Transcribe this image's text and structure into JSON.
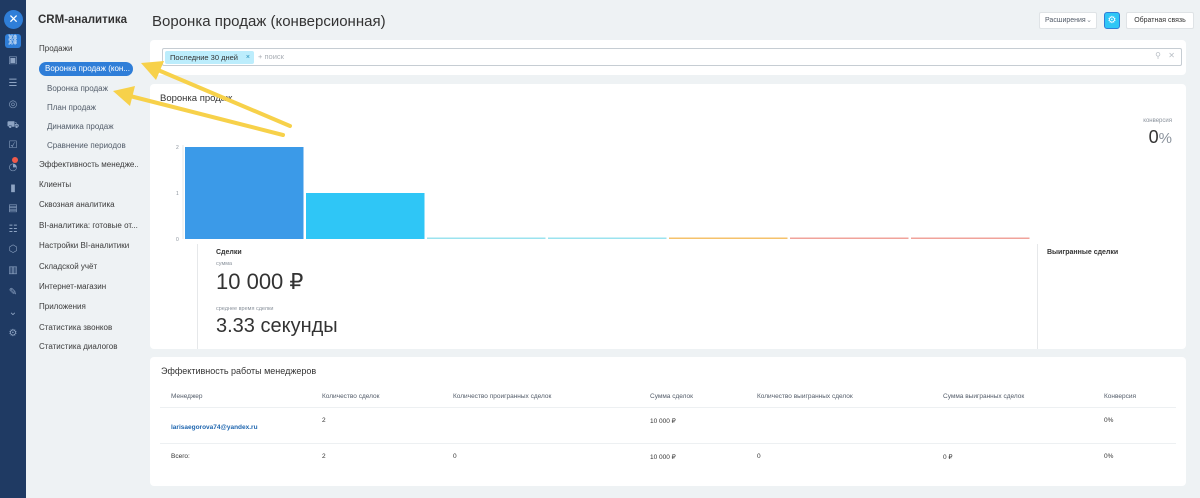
{
  "app": {
    "title": "CRM-аналитика"
  },
  "menu": {
    "items": [
      {
        "label": "Продажи",
        "level": 0
      },
      {
        "label": "Воронка продаж (кон...",
        "level": 0,
        "active": true
      },
      {
        "label": "Воронка продаж",
        "level": 1
      },
      {
        "label": "План продаж",
        "level": 1
      },
      {
        "label": "Динамика продаж",
        "level": 1
      },
      {
        "label": "Сравнение периодов",
        "level": 1
      },
      {
        "label": "Эффективность менедже...",
        "level": 0
      },
      {
        "label": "Клиенты",
        "level": 0
      },
      {
        "label": "Сквозная аналитика",
        "level": 0
      },
      {
        "label": "BI-аналитика: готовые от...",
        "level": 0
      },
      {
        "label": "Настройки BI-аналитики",
        "level": 0
      },
      {
        "label": "Складской учёт",
        "level": 0
      },
      {
        "label": "Интернет-магазин",
        "level": 0
      },
      {
        "label": "Приложения",
        "level": 0
      },
      {
        "label": "Статистика звонков",
        "level": 0
      },
      {
        "label": "Статистика диалогов",
        "level": 0
      }
    ]
  },
  "rail": {
    "close_icon": "✕"
  },
  "header": {
    "title": "Воронка продаж (конверсионная)",
    "extensions_label": "Расширения",
    "feedback_label": "Обратная связь"
  },
  "filter": {
    "chip_label": "Последние 30 дней",
    "chip_remove": "×",
    "search_placeholder": "+ поиск"
  },
  "funnel": {
    "title": "Воронка продаж",
    "conversion_label": "конверсия",
    "conversion_value": "0",
    "conversion_unit": "%",
    "deals_label": "Сделки",
    "sum_label": "сумма",
    "sum_value": "10 000 ₽",
    "avg_time_label": "среднее время сделки",
    "avg_time_value": "3.33 секунды",
    "won_label": "Выигранные сделки"
  },
  "chart_data": {
    "type": "bar",
    "categories": [
      "",
      "",
      "",
      "",
      "",
      "",
      ""
    ],
    "values": [
      2,
      1,
      0,
      0,
      0,
      0,
      0
    ],
    "colors": [
      "#3b9ae8",
      "#2fc6f6",
      "#9be3ef",
      "#9be3ef",
      "#f5c26b",
      "#f0a39b",
      "#f0a39b"
    ],
    "yticks": [
      "2",
      "1",
      "0"
    ],
    "ylim": [
      0,
      2
    ],
    "title": "",
    "xlabel": "",
    "ylabel": ""
  },
  "managers_table": {
    "title": "Эффективность работы менеджеров",
    "columns": [
      "Менеджер",
      "Количество сделок",
      "Количество проигранных сделок",
      "Сумма сделок",
      "Количество выигранных сделок",
      "Сумма выигранных сделок",
      "Конверсия"
    ],
    "rows": [
      [
        "larisaegorova74@yandex.ru",
        "2",
        "",
        "10 000 ₽",
        "",
        "",
        "0%"
      ]
    ],
    "total": [
      "Всего:",
      "2",
      "0",
      "10 000 ₽",
      "0",
      "0 ₽",
      "0%"
    ]
  },
  "colors": {
    "accent": "#2f7ed8",
    "arrow": "#f7d14a"
  }
}
